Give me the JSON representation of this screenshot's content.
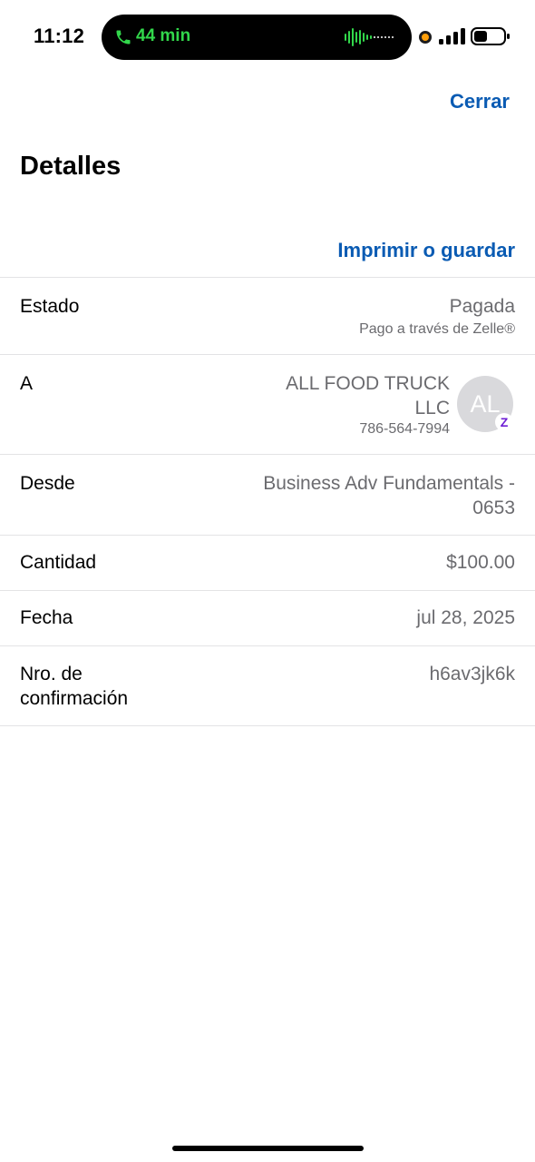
{
  "status_bar": {
    "time": "11:12",
    "call_timer": "44 min",
    "call_color": "#32d74b",
    "icons": [
      "phone-icon",
      "audio-waveform-icon",
      "recording-dot-icon",
      "signal-icon",
      "battery-icon"
    ]
  },
  "header": {
    "close_label": "Cerrar",
    "title": "Detalles",
    "print_label": "Imprimir o guardar",
    "accent_color": "#0a5bb3"
  },
  "details": {
    "status": {
      "label": "Estado",
      "value": "Pagada",
      "sub": "Pago a través de Zelle®"
    },
    "recipient": {
      "label": "A",
      "name_line1": "ALL FOOD TRUCK",
      "name_line2": "LLC",
      "phone": "786-564-7994",
      "avatar_initials": "AL",
      "badge_icon": "zelle-icon",
      "badge_glyph": "Z"
    },
    "from": {
      "label": "Desde",
      "value_line1": "Business Adv Fundamentals -",
      "value_line2": "0653"
    },
    "amount": {
      "label": "Cantidad",
      "value": "$100.00"
    },
    "date": {
      "label": "Fecha",
      "value": "jul 28, 2025"
    },
    "confirmation": {
      "label_line1": "Nro. de",
      "label_line2": "confirmación",
      "value": "h6av3jk6k"
    }
  }
}
